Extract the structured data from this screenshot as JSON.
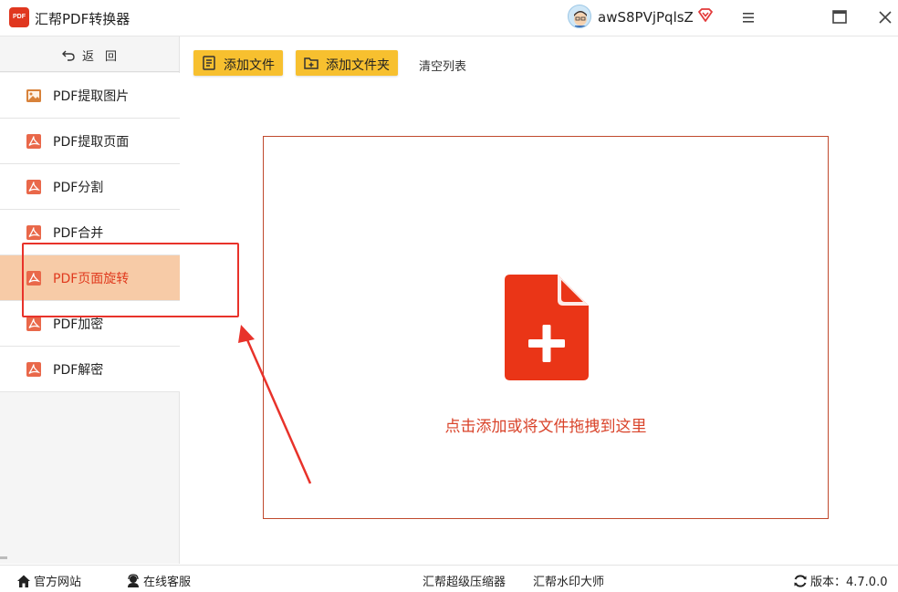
{
  "app": {
    "title": "汇帮PDF转换器",
    "logo_text": "PDF",
    "username": "awS8PVjPqlsZ"
  },
  "sidebar": {
    "back_label": "返回",
    "items": [
      {
        "label": "PDF提取图片",
        "icon": "image-icon"
      },
      {
        "label": "PDF提取页面",
        "icon": "pdf-icon"
      },
      {
        "label": "PDF分割",
        "icon": "pdf-icon"
      },
      {
        "label": "PDF合并",
        "icon": "pdf-icon"
      },
      {
        "label": "PDF页面旋转",
        "icon": "pdf-icon",
        "active": true
      },
      {
        "label": "PDF加密",
        "icon": "pdf-icon"
      },
      {
        "label": "PDF解密",
        "icon": "pdf-icon"
      }
    ]
  },
  "toolbar": {
    "add_file": "添加文件",
    "add_folder": "添加文件夹",
    "clear_list": "清空列表"
  },
  "dropzone": {
    "hint": "点击添加或将文件拖拽到这里"
  },
  "statusbar": {
    "official_site": "官方网站",
    "online_service": "在线客服",
    "compressor": "汇帮超级压缩器",
    "watermark": "汇帮水印大师",
    "version_label": "版本：4.7.0.0"
  },
  "colors": {
    "accent": "#f7c02f",
    "active_bg": "#f7cba7",
    "brand_red": "#e0371f",
    "annotation": "#e8322a"
  }
}
